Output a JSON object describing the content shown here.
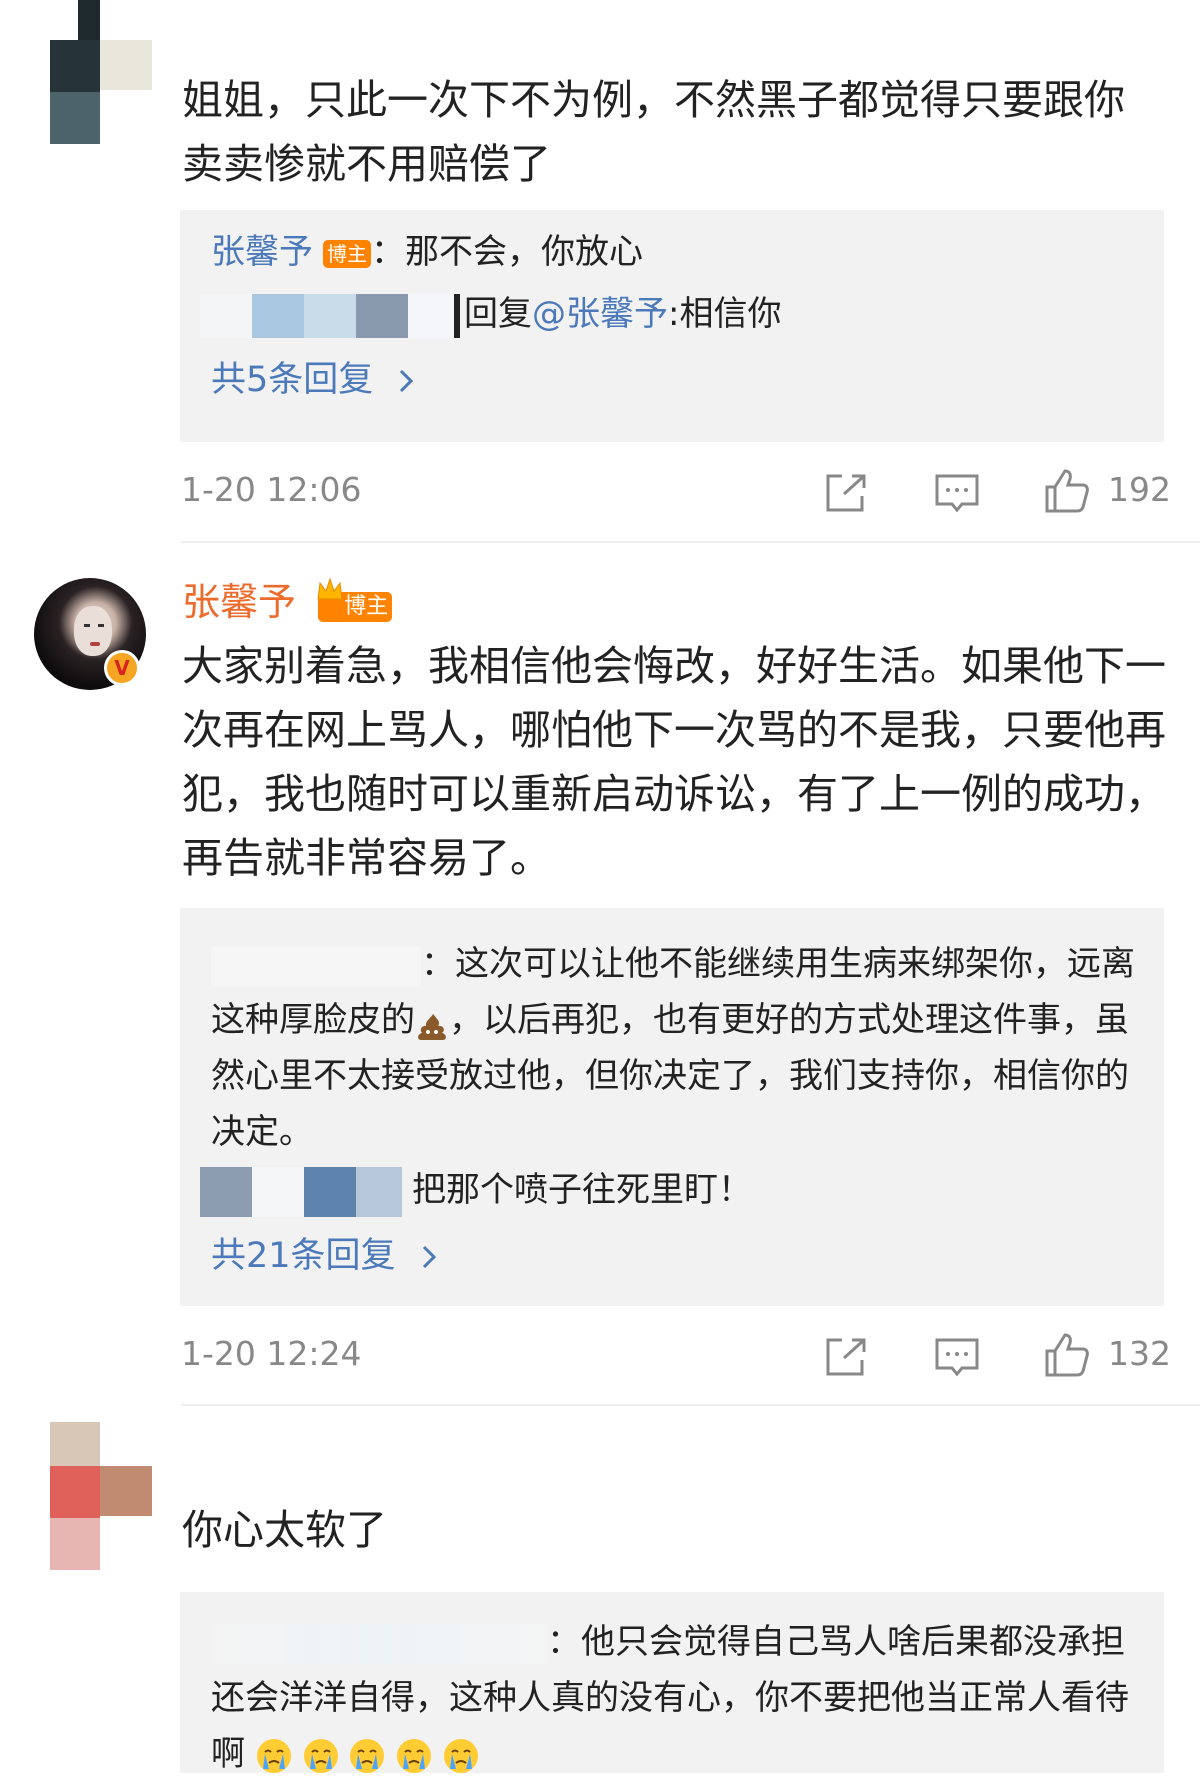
{
  "comments": [
    {
      "text": "姐姐，只此一次下不为例，不然黑子都觉得只要跟你卖卖惨就不用赔偿了",
      "replies": [
        {
          "user": "张馨予",
          "badge": "博主",
          "text": "：那不会，你放心"
        },
        {
          "prefix": "回复",
          "mention": "@张馨予",
          "text": ":相信你"
        }
      ],
      "more_replies": "共5条回复",
      "timestamp": "1-20 12:06",
      "likes": "192"
    },
    {
      "username": "张馨予",
      "badge": "博主",
      "text": "大家别着急，我相信他会悔改，好好生活。如果他下一次再在网上骂人，哪怕他下一次骂的不是我，只要他再犯，我也随时可以重新启动诉讼，有了上一例的成功，再告就非常容易了。",
      "replies": [
        {
          "text": "：这次可以让他不能继续用生病来绑架你，远离这种厚脸皮的",
          "text_after_emoji": "，以后再犯，也有更好的方式处理这件事，虽然心里不太接受放过他，但你决定了，我们支持你，相信你的决定。"
        },
        {
          "text": "把那个喷子往死里盯！"
        }
      ],
      "more_replies": "共21条回复",
      "timestamp": "1-20 12:24",
      "likes": "132"
    },
    {
      "text": "你心太软了",
      "replies": [
        {
          "text": "：他只会觉得自己骂人啥后果都没承担还会洋洋自得，这种人真的没有心，你不要把他当正常人看待啊"
        }
      ]
    }
  ],
  "icons": {
    "share": "share-icon",
    "comment": "comment-icon",
    "like": "thumbs-up-icon",
    "chevron": "chevron-right-icon",
    "verified": "verified-v-icon",
    "crown": "crown-icon",
    "poop": "poop-emoji-icon",
    "crying": "crying-emoji-icon"
  },
  "colors": {
    "link": "#4b79b9",
    "badge": "#ff8200",
    "username_highlight": "#ec6b2d",
    "reply_bg": "#f2f2f2"
  }
}
